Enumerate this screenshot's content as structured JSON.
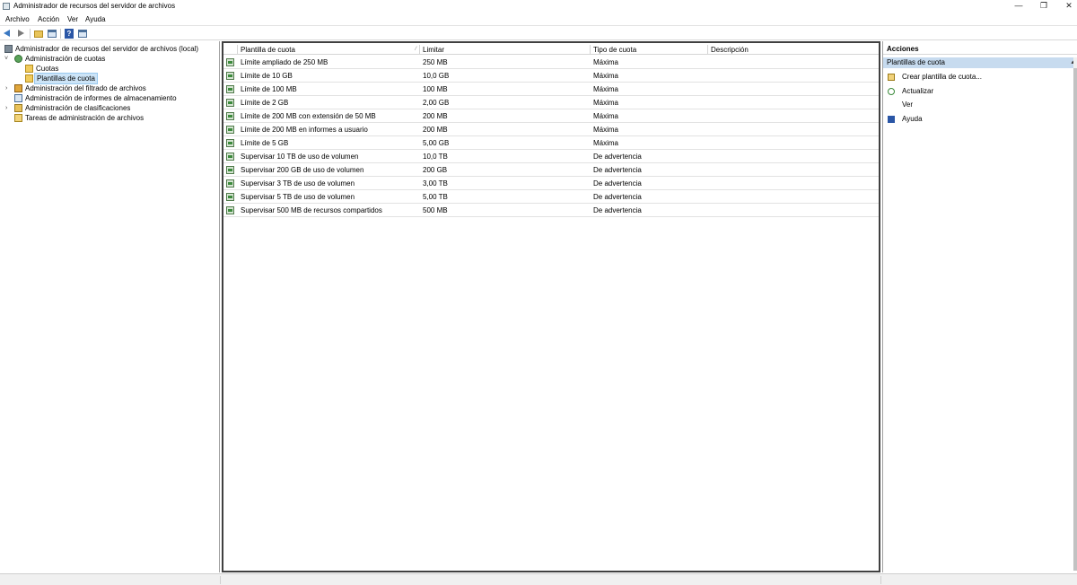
{
  "window": {
    "title": "Administrador de recursos del servidor de archivos",
    "minimize_glyph": "—",
    "maximize_glyph": "❐",
    "close_glyph": "✕"
  },
  "menu": {
    "items": [
      "Archivo",
      "Acción",
      "Ver",
      "Ayuda"
    ]
  },
  "toolbar": {
    "icons": [
      "back-arrow-icon",
      "forward-arrow-icon",
      "folder-up-icon",
      "show-hide-tree-icon",
      "help-icon",
      "show-hide-actions-icon"
    ],
    "help_glyph": "?"
  },
  "tree": {
    "items": [
      {
        "label": "Administrador de recursos del servidor de archivos (local)",
        "level": 0,
        "expander": "",
        "icon": "server-icon"
      },
      {
        "label": "Administración de cuotas",
        "level": 1,
        "expander": "˅",
        "icon": "quota-icon"
      },
      {
        "label": "Cuotas",
        "level": 2,
        "expander": "",
        "icon": "folder-icon"
      },
      {
        "label": "Plantillas de cuota",
        "level": 2,
        "expander": "",
        "icon": "folder-icon",
        "selected": true
      },
      {
        "label": "Administración del filtrado de archivos",
        "level": 1,
        "expander": "›",
        "icon": "filter-icon"
      },
      {
        "label": "Administración de informes de almacenamiento",
        "level": 1,
        "expander": "",
        "icon": "report-icon"
      },
      {
        "label": "Administración de clasificaciones",
        "level": 1,
        "expander": "›",
        "icon": "classification-icon"
      },
      {
        "label": "Tareas de administración de archivos",
        "level": 1,
        "expander": "",
        "icon": "task-icon"
      }
    ]
  },
  "list": {
    "columns": [
      "Plantilla de cuota",
      "Limitar",
      "Tipo de cuota",
      "Descripción"
    ],
    "sort_glyph": "⁄",
    "rows": [
      {
        "name": "Límite ampliado de 250 MB",
        "limit": "250 MB",
        "type": "Máxima",
        "description": ""
      },
      {
        "name": "Límite de 10 GB",
        "limit": "10,0 GB",
        "type": "Máxima",
        "description": ""
      },
      {
        "name": "Límite de 100 MB",
        "limit": "100 MB",
        "type": "Máxima",
        "description": ""
      },
      {
        "name": "Límite de 2 GB",
        "limit": "2,00 GB",
        "type": "Máxima",
        "description": ""
      },
      {
        "name": "Límite de 200 MB con extensión de 50 MB",
        "limit": "200 MB",
        "type": "Máxima",
        "description": ""
      },
      {
        "name": "Límite de 200 MB en informes a usuario",
        "limit": "200 MB",
        "type": "Máxima",
        "description": ""
      },
      {
        "name": "Límite de 5 GB",
        "limit": "5,00 GB",
        "type": "Máxima",
        "description": ""
      },
      {
        "name": "Supervisar 10 TB de uso de volumen",
        "limit": "10,0 TB",
        "type": "De advertencia",
        "description": ""
      },
      {
        "name": "Supervisar 200 GB de uso de volumen",
        "limit": "200 GB",
        "type": "De advertencia",
        "description": ""
      },
      {
        "name": "Supervisar 3 TB de uso de volumen",
        "limit": "3,00 TB",
        "type": "De advertencia",
        "description": ""
      },
      {
        "name": "Supervisar 5 TB de uso de volumen",
        "limit": "5,00 TB",
        "type": "De advertencia",
        "description": ""
      },
      {
        "name": "Supervisar 500 MB de recursos compartidos",
        "limit": "500 MB",
        "type": "De advertencia",
        "description": ""
      }
    ]
  },
  "actions": {
    "header": "Acciones",
    "section": "Plantillas de cuota",
    "section_caret": "▴",
    "items": [
      {
        "label": "Crear plantilla de cuota...",
        "icon": "create-template-icon"
      },
      {
        "label": "Actualizar",
        "icon": "refresh-icon"
      },
      {
        "label": "Ver",
        "icon": ""
      },
      {
        "label": "Ayuda",
        "icon": "help-icon"
      }
    ]
  }
}
